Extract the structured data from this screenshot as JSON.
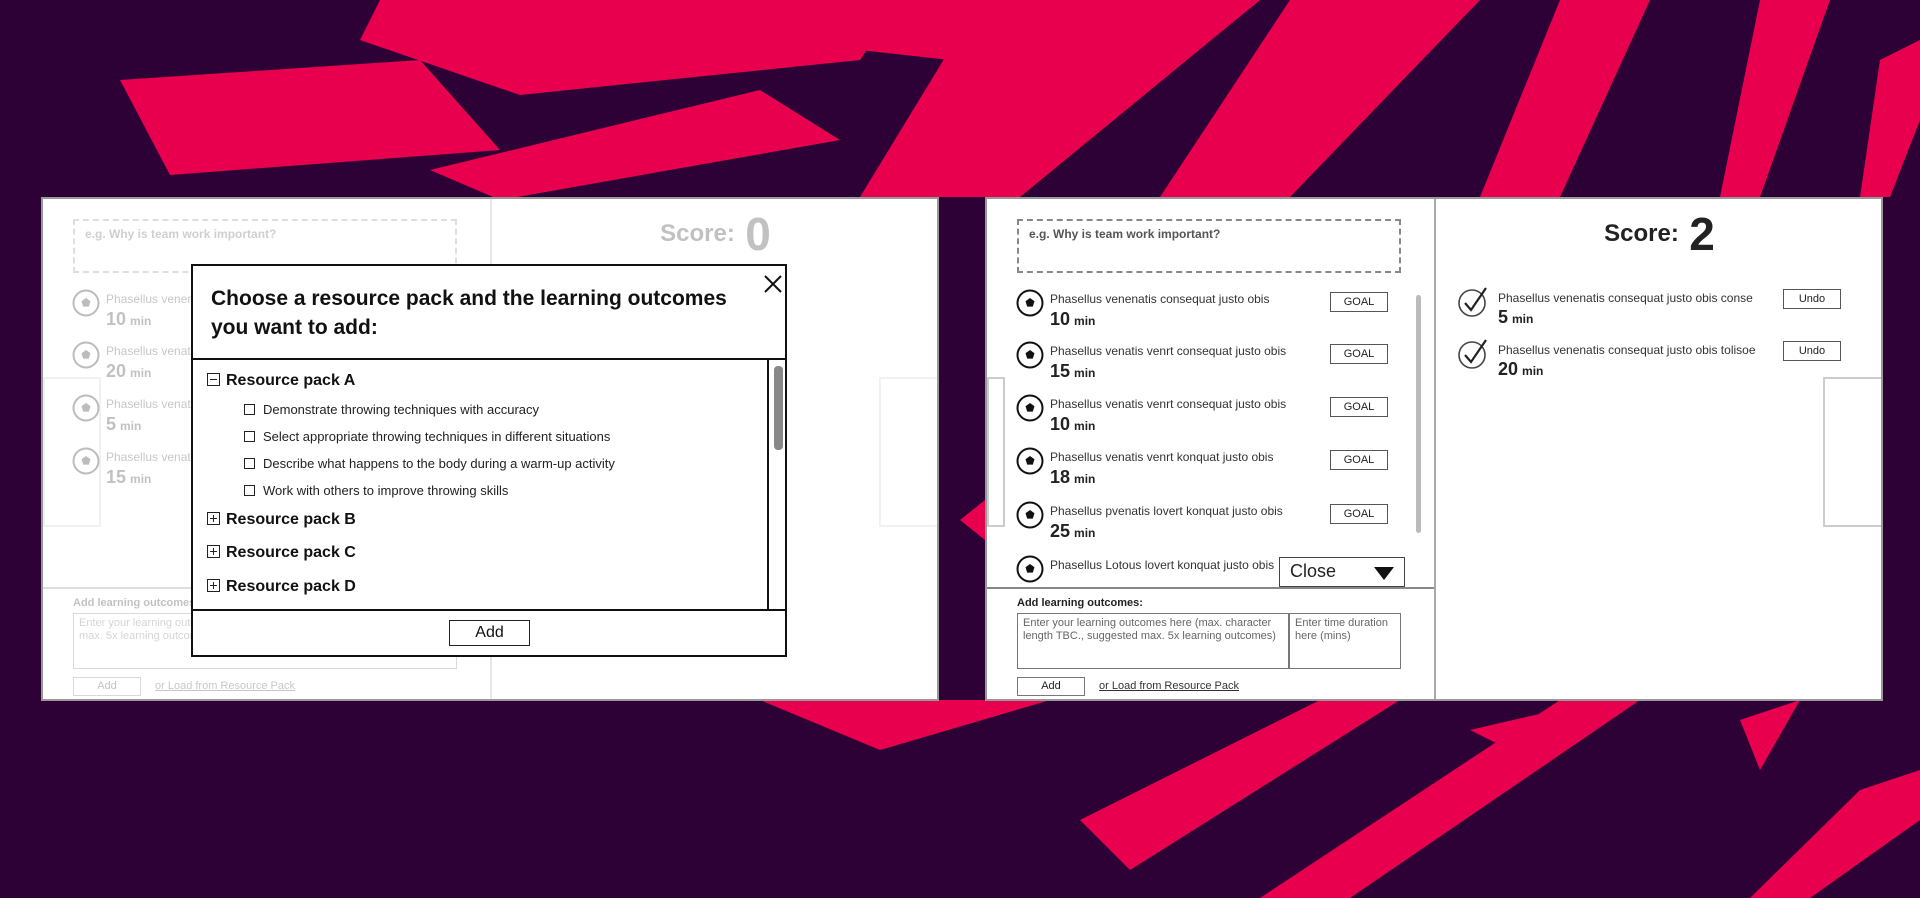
{
  "theme": {
    "background": "#2d0036",
    "accent": "#e8004f"
  },
  "left_screen": {
    "question_placeholder": "e.g. Why is team work important?",
    "score_label": "Score:",
    "score_value": "0",
    "items": [
      {
        "text": "Phasellus venenatis",
        "minutes": "10",
        "unit": "min"
      },
      {
        "text": "Phasellus venatis",
        "minutes": "20",
        "unit": "min"
      },
      {
        "text": "Phasellus venatis",
        "minutes": "5",
        "unit": "min"
      },
      {
        "text": "Phasellus venatis",
        "minutes": "15",
        "unit": "min"
      }
    ],
    "footer": {
      "label": "Add learning outcomes:",
      "outcomes_placeholder": "Enter your learning outcomes here (max. character length TBC., suggested max. 5x learning outcomes)",
      "add_label": "Add",
      "load_link": "or Load from Resource Pack"
    }
  },
  "modal": {
    "title": "Choose a resource pack and the learning outcomes you want to add:",
    "packs": [
      {
        "name": "Resource pack A",
        "expanded": true,
        "outcomes": [
          "Demonstrate throwing techniques with accuracy",
          "Select appropriate throwing techniques in different situations",
          "Describe what happens to the body during a warm-up activity",
          "Work with others to improve throwing skills"
        ]
      },
      {
        "name": "Resource pack B",
        "expanded": false
      },
      {
        "name": "Resource pack C",
        "expanded": false
      },
      {
        "name": "Resource pack D",
        "expanded": false
      }
    ],
    "add_label": "Add"
  },
  "right_screen": {
    "question_placeholder": "e.g. Why is team work important?",
    "score_label": "Score:",
    "score_value": "2",
    "items": [
      {
        "text": "Phasellus venenatis consequat justo obis",
        "minutes": "10",
        "unit": "min",
        "button": "GOAL"
      },
      {
        "text": "Phasellus venatis venrt consequat justo obis",
        "minutes": "15",
        "unit": "min",
        "button": "GOAL"
      },
      {
        "text": "Phasellus venatis venrt consequat justo obis",
        "minutes": "10",
        "unit": "min",
        "button": "GOAL"
      },
      {
        "text": "Phasellus venatis venrt konquat justo obis",
        "minutes": "18",
        "unit": "min",
        "button": "GOAL"
      },
      {
        "text": "Phasellus pvenatis lovert konquat justo obis",
        "minutes": "25",
        "unit": "min",
        "button": "GOAL"
      },
      {
        "text": "Phasellus Lotous lovert konquat justo obis",
        "minutes": "",
        "unit": "",
        "button": ""
      }
    ],
    "close_dropdown": "Close",
    "completed": [
      {
        "text": "Phasellus venenatis consequat justo obis conse",
        "minutes": "5",
        "unit": "min",
        "button": "Undo"
      },
      {
        "text": "Phasellus venenatis consequat justo obis tolisoe",
        "minutes": "20",
        "unit": "min",
        "button": "Undo"
      }
    ],
    "footer": {
      "label": "Add learning outcomes:",
      "outcomes_placeholder": "Enter your learning outcomes here (max. character length TBC., suggested max. 5x learning outcomes)",
      "time_placeholder": "Enter time duration here (mins)",
      "add_label": "Add",
      "load_link": "or Load from Resource Pack"
    }
  }
}
